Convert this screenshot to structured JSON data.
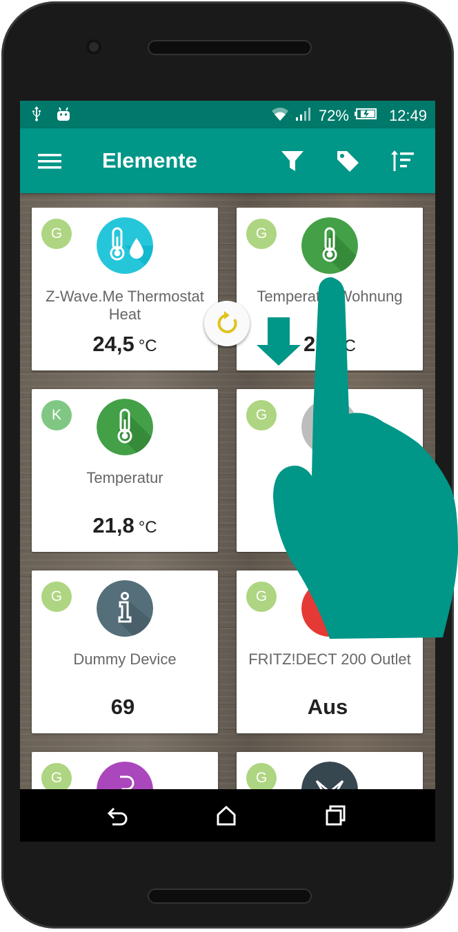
{
  "status_bar": {
    "battery": "72%",
    "time": "12:49",
    "icons": [
      "usb-icon",
      "android-debug-icon",
      "wifi-icon",
      "signal-icon",
      "battery-icon"
    ]
  },
  "app_bar": {
    "title": "Elemente",
    "icons": [
      "menu-icon",
      "filter-icon",
      "tag-icon",
      "sort-icon"
    ]
  },
  "cards": [
    {
      "badge": "G",
      "icon": "thermostat-icon",
      "name": "Z-Wave.Me Thermostat Heat",
      "value": "24,5",
      "unit": "°C"
    },
    {
      "badge": "G",
      "icon": "thermometer-icon",
      "name": "Temperatur Wohnung",
      "value": "21,",
      "unit": "°C"
    },
    {
      "badge": "K",
      "icon": "thermometer-icon",
      "name": "Temperatur",
      "value": "21,8",
      "unit": "°C"
    },
    {
      "badge": "G",
      "icon": "device-icon",
      "name": "",
      "value": "",
      "unit": ""
    },
    {
      "badge": "G",
      "icon": "info-icon",
      "name": "Dummy Device",
      "value": "69",
      "unit": ""
    },
    {
      "badge": "G",
      "icon": "outlet-icon",
      "name": "FRITZ!DECT 200 Outlet",
      "value": "Aus",
      "unit": ""
    },
    {
      "badge": "G",
      "icon": "letter-icon",
      "name": "",
      "value": "",
      "unit": ""
    },
    {
      "badge": "G",
      "icon": "device-icon",
      "name": "",
      "value": "",
      "unit": ""
    }
  ],
  "colors": {
    "primary": "#009688",
    "primary_dark": "#00796b",
    "badge_green": "#aed581",
    "hand_overlay": "#009688"
  }
}
